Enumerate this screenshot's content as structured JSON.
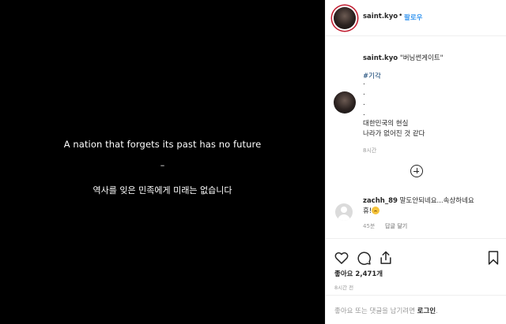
{
  "media": {
    "line1": "A nation that forgets its past has no future",
    "dash": "–",
    "line2": "역사를 잊은 민족에게 미래는 없습니다"
  },
  "header": {
    "username": "saint.kyo",
    "separator": "•",
    "follow_label": "팔로우"
  },
  "caption": {
    "username": "saint.kyo",
    "title": "\"버닝썬게이트\"",
    "hashtag": "#기각",
    "dots": [
      ".",
      ".",
      ".",
      "."
    ],
    "line1": "대한민국의 현실",
    "line2": "나라가 없어진 것 같다",
    "time": "8시간"
  },
  "comment": {
    "username": "zachh_89",
    "text_line1": "말도안되네요...속상하네요",
    "text_line2": "휴!",
    "emoji": "worried-face",
    "age": "45분",
    "reply_label": "답글 달기"
  },
  "actions": {
    "icons": [
      "heart-icon",
      "comment-icon",
      "share-icon",
      "bookmark-icon"
    ],
    "likes": "좋아요 2,471개",
    "posted": "8시간 전"
  },
  "comment_box": {
    "prompt": "좋아요 또는 댓글을 남기려면 ",
    "login_label": "로그인",
    "end": "."
  }
}
